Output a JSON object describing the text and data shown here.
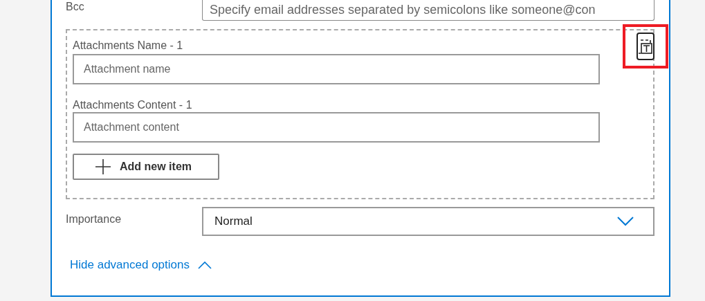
{
  "bcc": {
    "label": "Bcc",
    "placeholder": "Specify email addresses separated by semicolons like someone@con"
  },
  "attachments": {
    "items": [
      {
        "name_label": "Attachments Name - 1",
        "name_placeholder": "Attachment name",
        "content_label": "Attachments Content - 1",
        "content_placeholder": "Attachment content"
      }
    ],
    "add_button": "Add new item",
    "highlighted": true
  },
  "importance": {
    "label": "Importance",
    "value": "Normal"
  },
  "advanced_toggle": {
    "label": "Hide advanced options",
    "expanded": true
  }
}
